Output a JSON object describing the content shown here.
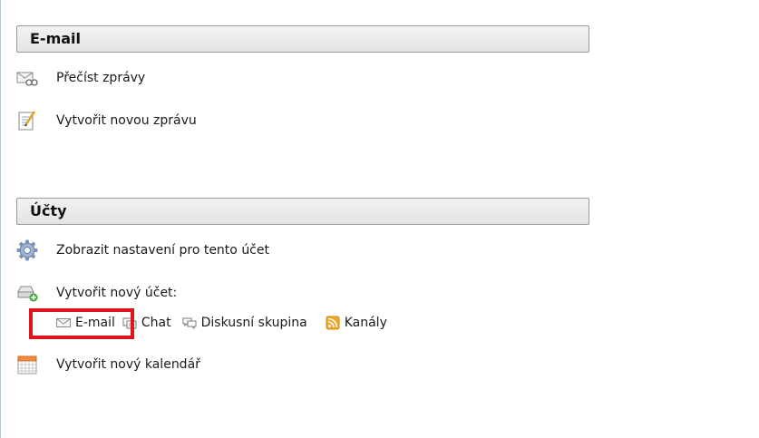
{
  "email_section": {
    "title": "E-mail",
    "items": [
      {
        "label": "Přečíst zprávy",
        "icon": "read-mail-icon"
      },
      {
        "label": "Vytvořit novou zprávu",
        "icon": "compose-icon"
      }
    ]
  },
  "accounts_section": {
    "title": "Účty",
    "settings_label": "Zobrazit nastavení pro tento účet",
    "new_account_label": "Vytvořit nový účet:",
    "new_account_links": [
      {
        "label": "E-mail",
        "icon": "envelope-icon"
      },
      {
        "label": "Chat",
        "icon": "chat-icon"
      },
      {
        "label": "Diskusní skupina",
        "icon": "newsgroup-icon"
      },
      {
        "label": "Kanály",
        "icon": "rss-icon"
      }
    ],
    "calendar_label": "Vytvořit nový kalendář"
  },
  "colors": {
    "highlight": "#e0141c",
    "rss": "#f5a623"
  }
}
